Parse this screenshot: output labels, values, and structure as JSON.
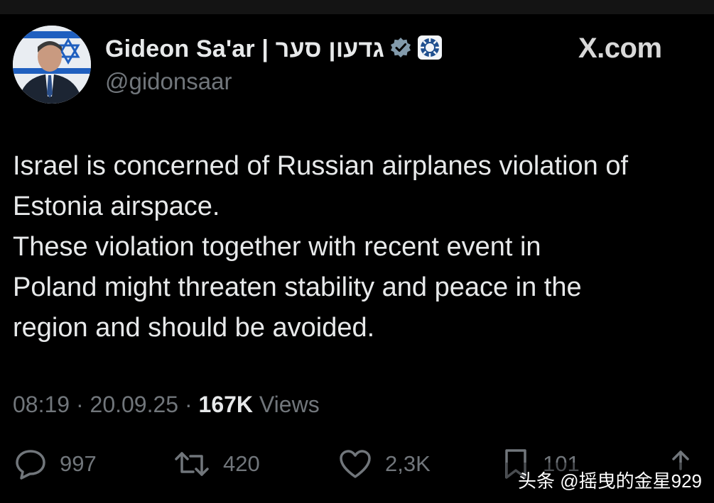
{
  "author": {
    "display_name": "Gideon Sa'ar | גדעון סער",
    "handle": "@gidonsaar",
    "verified": true
  },
  "brand": "X.com",
  "tweet": {
    "lines": [
      "Israel is concerned of Russian airplanes violation of",
      "Estonia airspace.",
      "These violation together with recent event in",
      "Poland might threaten stability and peace in the",
      "region and should be avoided."
    ]
  },
  "meta": {
    "time": "08:19",
    "date": "20.09.25",
    "separator": "·",
    "views_count": "167K",
    "views_label": "Views"
  },
  "actions": {
    "replies": "997",
    "reposts": "420",
    "likes": "2,3K",
    "bookmarks": "101"
  },
  "watermark": "头条 @摇曳的金星929",
  "colors": {
    "background": "#000000",
    "text": "#e7e9ea",
    "muted": "#71767b",
    "verified_badge": "#829aab"
  }
}
